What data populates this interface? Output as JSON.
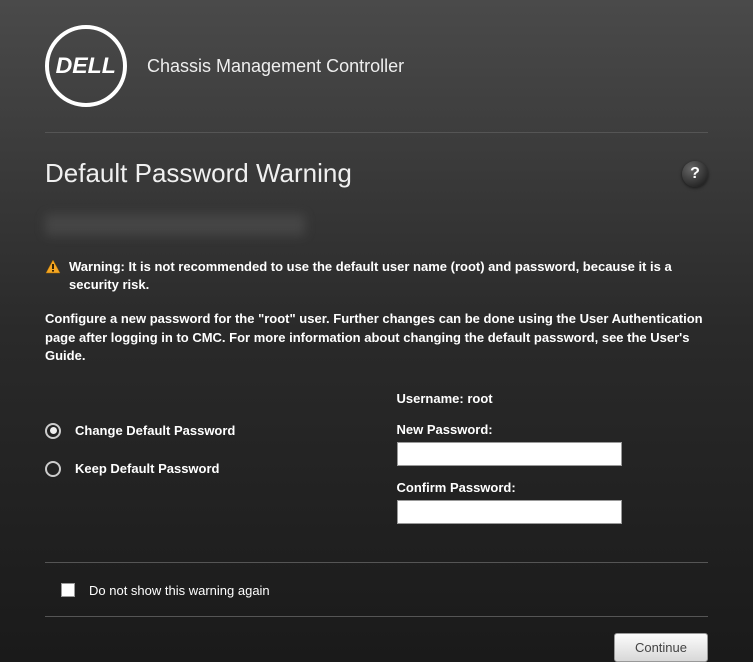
{
  "header": {
    "logo_text": "DELL",
    "product_title": "Chassis Management Controller"
  },
  "page": {
    "title": "Default Password Warning",
    "warning_text": "Warning: It is not recommended to use the default user name (root) and password, because it is a security risk.",
    "instruction_text": "Configure a new password for the \"root\" user. Further changes can be done using the User Authentication page after logging in to CMC. For more information about changing the default password, see the User's Guide."
  },
  "form": {
    "username_label": "Username:",
    "username_value": "root",
    "new_password_label": "New Password:",
    "confirm_password_label": "Confirm Password:",
    "radios": {
      "change": "Change Default Password",
      "keep": "Keep Default Password"
    },
    "checkbox_label": "Do not show this warning again",
    "continue_label": "Continue"
  }
}
